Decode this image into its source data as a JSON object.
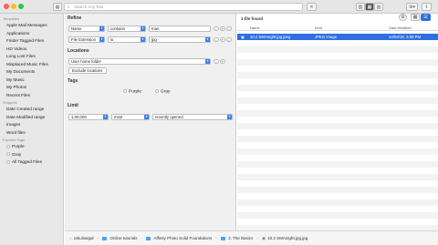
{
  "search": {
    "placeholder": "Search Any Text"
  },
  "sidebar": {
    "sections": {
      "templates": "Templates",
      "snippets": "Snippets",
      "favorite_tags": "Favorite Tags"
    },
    "templates": [
      "Apple Mail Messages",
      "Applications",
      "Finder Tagged Files",
      "HD Videos",
      "Long Lost Files",
      "Misplaced Music Files",
      "My Documents",
      "My Music",
      "My Photos",
      "Recent Files"
    ],
    "snippets": [
      "Date Created range",
      "Date Modified range",
      "Images",
      "Word files"
    ],
    "tags": [
      "Purple",
      "Gray",
      "All Tagged Files"
    ]
  },
  "refine": {
    "title": "Refine",
    "row1": {
      "field": "Name",
      "op": "contains",
      "value": "man"
    },
    "row2": {
      "field": "File Extension",
      "op": "is",
      "value": "jpg"
    },
    "locations_title": "Locations",
    "location_value": "User home folder",
    "exclude_label": "Exclude locations",
    "tags_title": "Tags",
    "tag_options": [
      "Purple",
      "Gray"
    ],
    "limit_title": "Limit",
    "limit": {
      "count": "1,00,000",
      "order": "most",
      "sort": "recently opened"
    },
    "buttons": {
      "minus": "-",
      "plus": "+",
      "more": "..."
    }
  },
  "results": {
    "count_label": "1 file found",
    "columns": {
      "name": "Name",
      "kind": "Kind",
      "date": "Date Modified"
    },
    "rows": [
      {
        "name": "10.2 SMAnight.jpg.jpeg",
        "kind": "JPEG image",
        "date": "14/04/18, 3:08 PM"
      }
    ]
  },
  "pathbar": [
    "rahulsaigal",
    "Online tutorials",
    "Affinity Photo Solid Foundations",
    "2. The Basics",
    "10.2 SMAnight.jpg.jpg"
  ]
}
